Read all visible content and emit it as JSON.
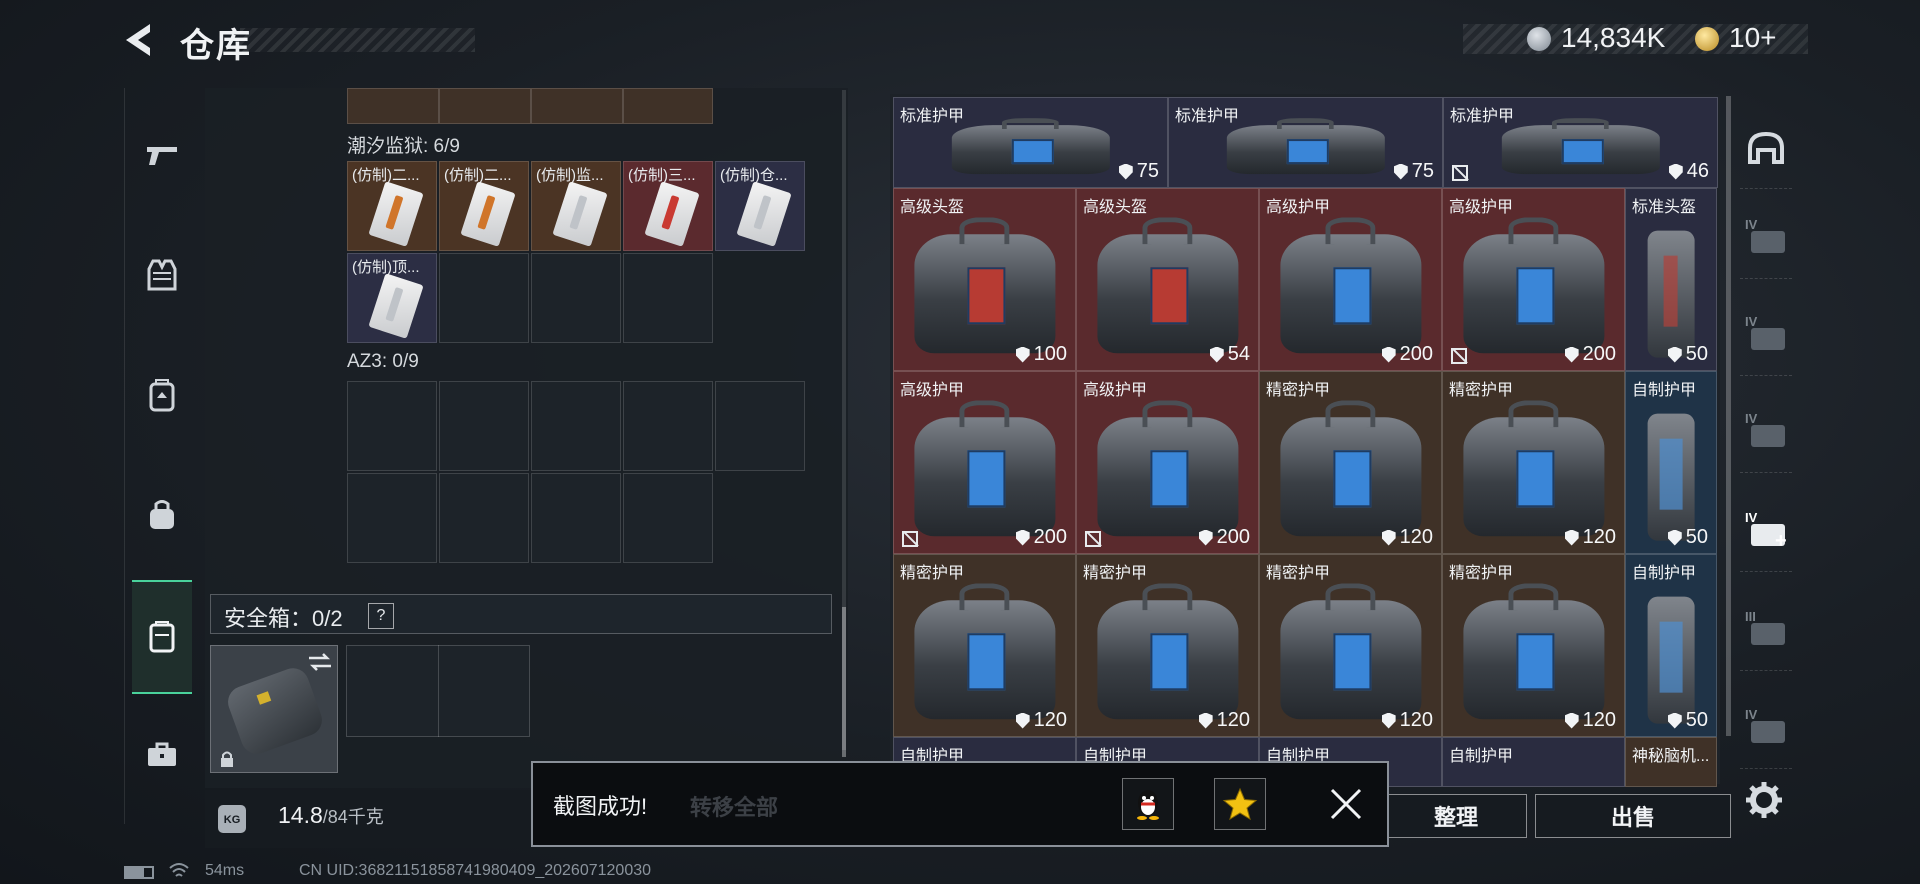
{
  "header": {
    "title": "仓库",
    "currency_silver": "14,834K",
    "currency_gold": "10+"
  },
  "side_nav": {
    "items": [
      "pistol-icon",
      "vest-icon",
      "chest-rig-icon",
      "backpack-icon",
      "safe-case-icon",
      "briefcase-icon"
    ],
    "active_index": 4
  },
  "left_panel": {
    "section1_label": "潮汐监狱: 6/9",
    "section1_items": [
      {
        "label": "(仿制)二...",
        "color": "orange",
        "stripe": "#d0752a"
      },
      {
        "label": "(仿制)二...",
        "color": "orange",
        "stripe": "#d0752a"
      },
      {
        "label": "(仿制)监...",
        "color": "orange",
        "stripe": "#bfc3c8"
      },
      {
        "label": "(仿制)三...",
        "color": "red",
        "stripe": "#c93a32"
      },
      {
        "label": "(仿制)仓...",
        "color": "blue",
        "stripe": "#bfc3c8"
      },
      {
        "label": "(仿制)顶...",
        "color": "blue",
        "stripe": "#bfc3c8"
      }
    ],
    "section2_label": "AZ3: 0/9",
    "safe_label": "安全箱：0/2",
    "safe_help": "?",
    "weight_value": "14.8",
    "weight_max": "/84千克",
    "kg_label": "KG"
  },
  "grid": {
    "rows": [
      [
        {
          "name": "标准护甲",
          "value": "75",
          "color": "navy",
          "kind": "bag"
        },
        {
          "name": "标准护甲",
          "value": "75",
          "color": "navy",
          "kind": "bag"
        },
        {
          "name": "标准护甲",
          "value": "46",
          "color": "navy",
          "kind": "bag",
          "noshow": true
        }
      ],
      [
        {
          "name": "高级头盔",
          "value": "100",
          "color": "red",
          "kind": "bag-red"
        },
        {
          "name": "高级头盔",
          "value": "54",
          "color": "red",
          "kind": "bag-red"
        },
        {
          "name": "高级护甲",
          "value": "200",
          "color": "red",
          "kind": "bag"
        },
        {
          "name": "高级护甲",
          "value": "200",
          "color": "red",
          "kind": "bag",
          "noshow": true
        },
        {
          "name": "标准头盔",
          "value": "50",
          "color": "navy",
          "kind": "pack-red"
        }
      ],
      [
        {
          "name": "高级护甲",
          "value": "200",
          "color": "red",
          "kind": "bag",
          "noshow": true
        },
        {
          "name": "高级护甲",
          "value": "200",
          "color": "red",
          "kind": "bag",
          "noshow": true
        },
        {
          "name": "精密护甲",
          "value": "120",
          "color": "brown",
          "kind": "bag"
        },
        {
          "name": "精密护甲",
          "value": "120",
          "color": "brown",
          "kind": "bag"
        },
        {
          "name": "自制护甲",
          "value": "50",
          "color": "blue",
          "kind": "pack"
        }
      ],
      [
        {
          "name": "精密护甲",
          "value": "120",
          "color": "brown",
          "kind": "bag"
        },
        {
          "name": "精密护甲",
          "value": "120",
          "color": "brown",
          "kind": "bag"
        },
        {
          "name": "精密护甲",
          "value": "120",
          "color": "brown",
          "kind": "bag"
        },
        {
          "name": "精密护甲",
          "value": "120",
          "color": "brown",
          "kind": "bag"
        },
        {
          "name": "自制护甲",
          "value": "50",
          "color": "blue",
          "kind": "pack"
        }
      ],
      [
        {
          "name": "自制护甲",
          "value": "",
          "color": "navy",
          "kind": "none"
        },
        {
          "name": "自制护甲",
          "value": "",
          "color": "navy",
          "kind": "none"
        },
        {
          "name": "自制护甲",
          "value": "",
          "color": "navy",
          "kind": "none"
        },
        {
          "name": "自制护甲",
          "value": "",
          "color": "navy",
          "kind": "none"
        },
        {
          "name": "神秘脑机...",
          "value": "",
          "color": "brown",
          "kind": "none"
        }
      ]
    ]
  },
  "right_nav": {
    "items": [
      "helmet-icon",
      "armor-tier-4-icon",
      "armor-tier-4-icon",
      "armor-tier-4-icon",
      "armor-tier-4-plus-icon",
      "armor-tier-3-icon",
      "armor-tier-4-icon"
    ],
    "labels": [
      "",
      "IV",
      "IV",
      "IV",
      "IV",
      "III",
      "IV"
    ]
  },
  "buttons": {
    "sort": "整理",
    "sell": "出售",
    "hidden": "转移全部"
  },
  "toast": {
    "message": "截图成功!"
  },
  "status": {
    "ping": "54ms",
    "uid": "CN UID:36821151858741980409_202607120030"
  },
  "colors": {
    "accent": "#49d29b",
    "navy": "#2a2c40",
    "red": "#5a2a2d",
    "brown": "#3f3127",
    "blue": "#1f3347"
  }
}
